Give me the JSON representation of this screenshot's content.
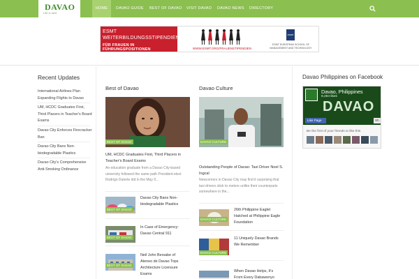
{
  "logo": {
    "name": "DAVAO",
    "tagline": "Life is here"
  },
  "nav": [
    {
      "label": "HOME",
      "active": true
    },
    {
      "label": "DAVAO GUIDE"
    },
    {
      "label": "BEST OF DAVAO"
    },
    {
      "label": "VISIT DAVAO"
    },
    {
      "label": "DAVAO NEWS"
    },
    {
      "label": "DIRECTORY"
    }
  ],
  "banner": {
    "line1": "ESMT",
    "line2": "WEITERBILDUNGSSTIPENDIEN",
    "line3": "FÜR FRAUEN IN FÜHRUNGSPOSITIONEN",
    "url": "WWW.ESMT.ORG/FRAUENSTIPENDIEN",
    "logo": "esmt",
    "org": "ESMT EUROPEAN SCHOOL OF MANAGEMENT AND TECHNOLOGY"
  },
  "recent": {
    "title": "Recent Updates",
    "items": [
      "International Airlines Plan Expanding Flights to Davao",
      "UM, HCDC Graduates First, Third Placers in Teacher's Board Exams",
      "Davao City Enforces Firecracker Ban",
      "Davao City Bans Non-biodegradable Plastics",
      "Davao City's Comprehensive Anti-Smoking Ordinance"
    ]
  },
  "best": {
    "title": "Best of Davao",
    "badge": "BEST OF DAVAO",
    "hero_title": "UM, HCDC Graduates First, Third Placers in Teacher's Board Exams",
    "hero_excerpt": "An education graduate from a Davao City-based university followed the same path President-elect Rodrigo Duterte did in the May 9...",
    "items": [
      "Davao City Bans Non-biodegradable Plastics",
      "In Case of Emergency: Davao Central 911",
      "Neil John Bersabe of Ateneo de Davao Tops Architecture Licensure Exams"
    ]
  },
  "culture": {
    "title": "Davao Culture",
    "badge": "DAVAO CULTURE",
    "hero_title": "Outstanding People of Davao: Taxi Driver Noel S. Ingcal",
    "hero_excerpt": "Newcomers in Davao City may find it surprising that taxi drivers stick to meters unlike their counterparts somewhere in the...",
    "items": [
      "26th Philippine Eaglet Hatched at Philippine Eagle Foundation",
      "11 Uniquely Davao Brands We Remember",
      "When Davao Helps, It's From Every Dabawenyo"
    ]
  },
  "facebook": {
    "title": "Davao Philippines on Facebook",
    "page_name": "Davao, Philippines",
    "likes": "8,284 likes",
    "cover_word": "DAVAO",
    "like_label": "Like Page",
    "share_label": "Sh",
    "friends_text": "Be the first of your friends to like this"
  },
  "colors": {
    "accent": "#8bbf4f",
    "accent_light": "#a8d26f",
    "fb_blue": "#4267b2"
  }
}
